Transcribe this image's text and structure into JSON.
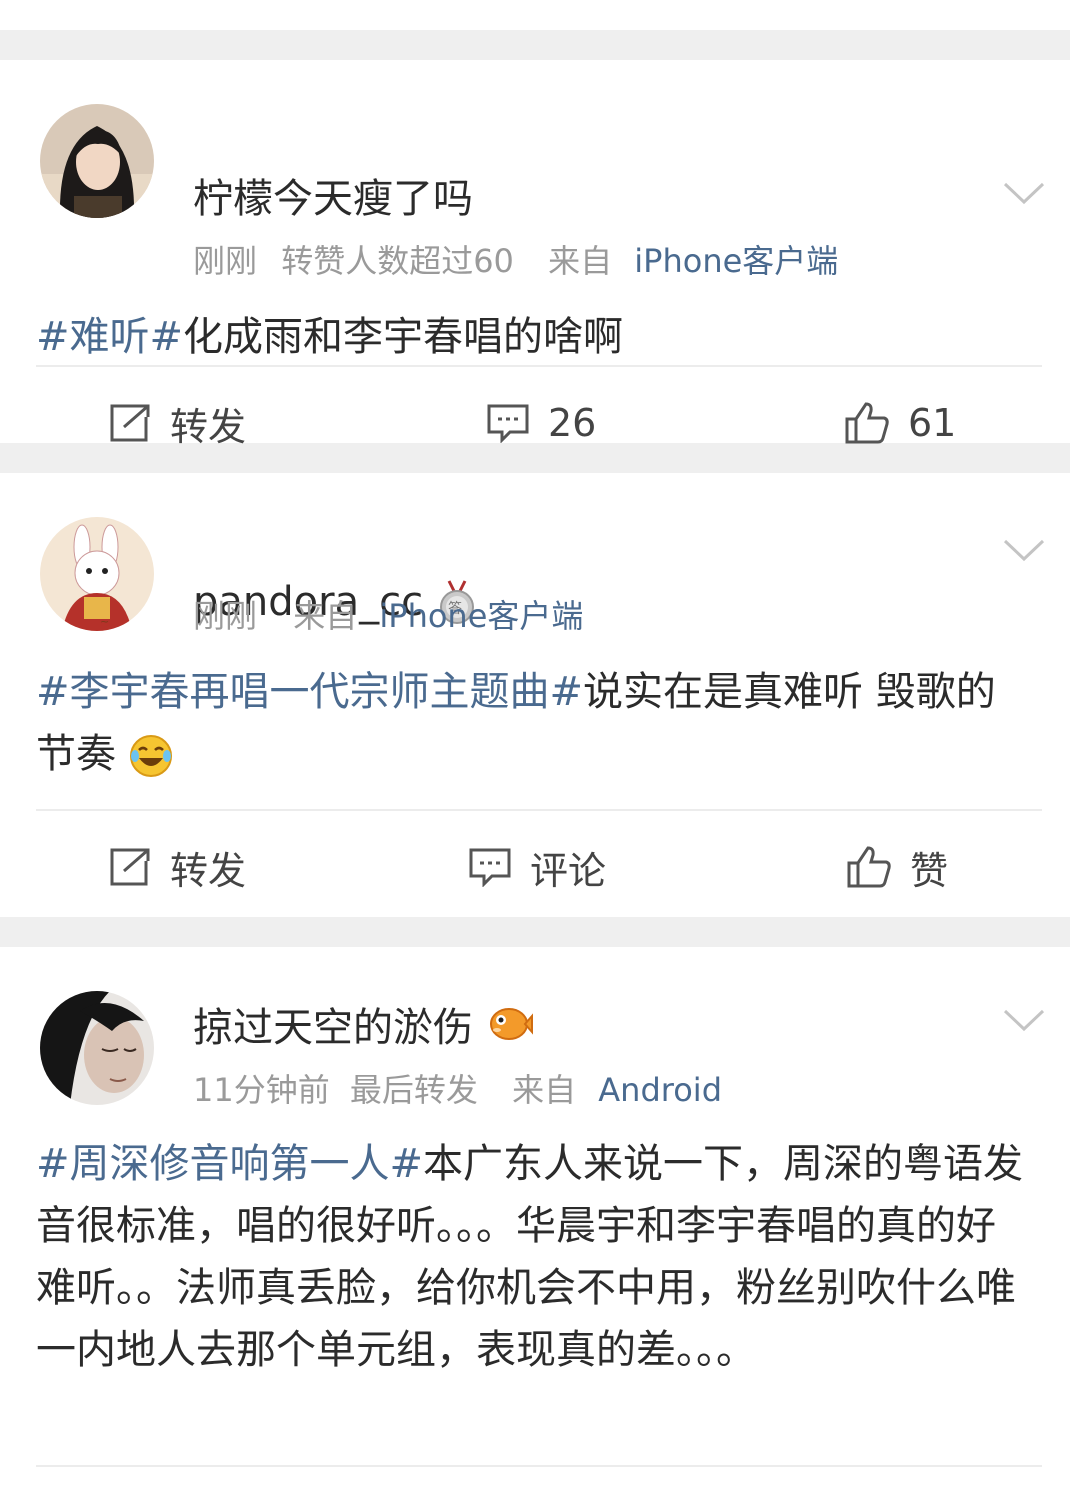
{
  "posts": [
    {
      "username": "柠檬今天瘦了吗",
      "time": "刚刚",
      "note": "转赞人数超过60",
      "source_prefix": "来自",
      "source": "iPhone客户端",
      "text": {
        "tag": "#难听#",
        "rest": "化成雨和李宇春唱的啥啊"
      },
      "actions": {
        "repost": "转发",
        "comment": "26",
        "like": "61"
      }
    },
    {
      "username": "pandora_cc",
      "badge_icon": "medal-answer-icon",
      "time": "刚刚",
      "source_prefix": "来自",
      "source": "iPhone客户端",
      "text": {
        "tag": "#李宇春再唱一代宗师主题曲#",
        "rest": "说实在是真难听 毁歌的节奏",
        "emoji": "laugh-cry-emoji"
      },
      "actions": {
        "repost": "转发",
        "comment": "评论",
        "like": "赞"
      }
    },
    {
      "username": "掠过天空的淤伤",
      "badge_icon": "pufferfish-icon",
      "time": "11分钟前",
      "note": "最后转发",
      "source_prefix": "来自",
      "source": "Android",
      "text": {
        "tag": "#周深修音响第一人#",
        "rest": "本广东人来说一下，周深的粤语发音很标准，唱的很好听。。。华晨宇和李宇春唱的真的好难听。。法师真丢脸，给你机会不中用，粉丝别吹什么唯一内地人去那个单元组，表现真的差。。。"
      }
    }
  ],
  "colors": {
    "link": "#4a6a8f",
    "separator": "#efefef",
    "meta": "#9a9a9a"
  }
}
